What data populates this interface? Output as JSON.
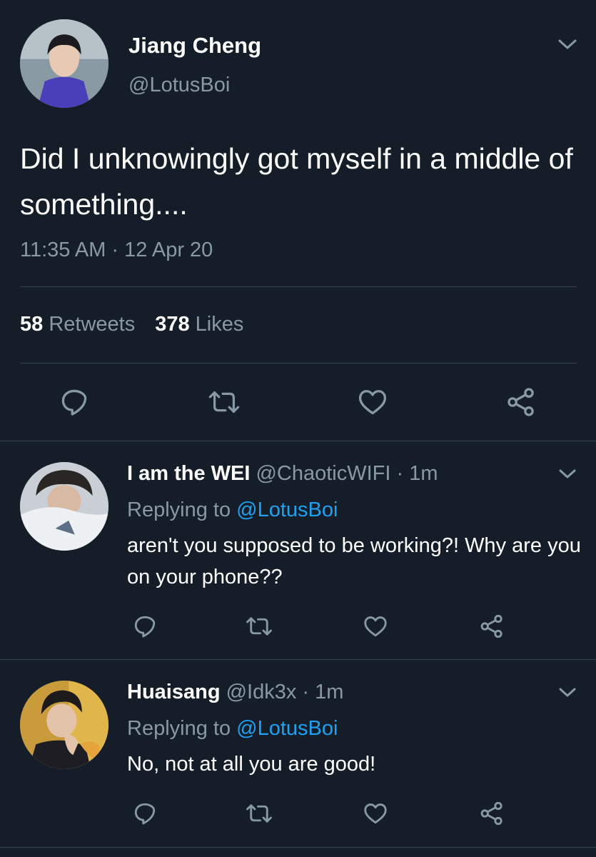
{
  "main_tweet": {
    "display_name": "Jiang Cheng",
    "handle": "@LotusBoi",
    "text": "Did I unknowingly got myself in a middle of something....",
    "timestamp": "11:35 AM · 12 Apr 20",
    "retweets_count": "58",
    "retweets_label": "Retweets",
    "likes_count": "378",
    "likes_label": "Likes",
    "icons": [
      "reply-icon",
      "retweet-icon",
      "like-icon",
      "share-icon"
    ]
  },
  "replies": [
    {
      "display_name": "I am the WEI",
      "handle": "@ChaoticWIFI",
      "time": "1m",
      "replying_prefix": "Replying to",
      "replying_to": "@LotusBoi",
      "text": "aren't you supposed to be working?! Why are you on your phone??"
    },
    {
      "display_name": "Huaisang",
      "handle": "@Idk3x",
      "time": "1m",
      "replying_prefix": "Replying to",
      "replying_to": "@LotusBoi",
      "text": "No, not at all you are good!"
    }
  ],
  "colors": {
    "background": "#151e28",
    "primary_text": "#ffffff",
    "secondary_text": "#8899a6",
    "link": "#1da1f2",
    "divider": "#38444d"
  }
}
